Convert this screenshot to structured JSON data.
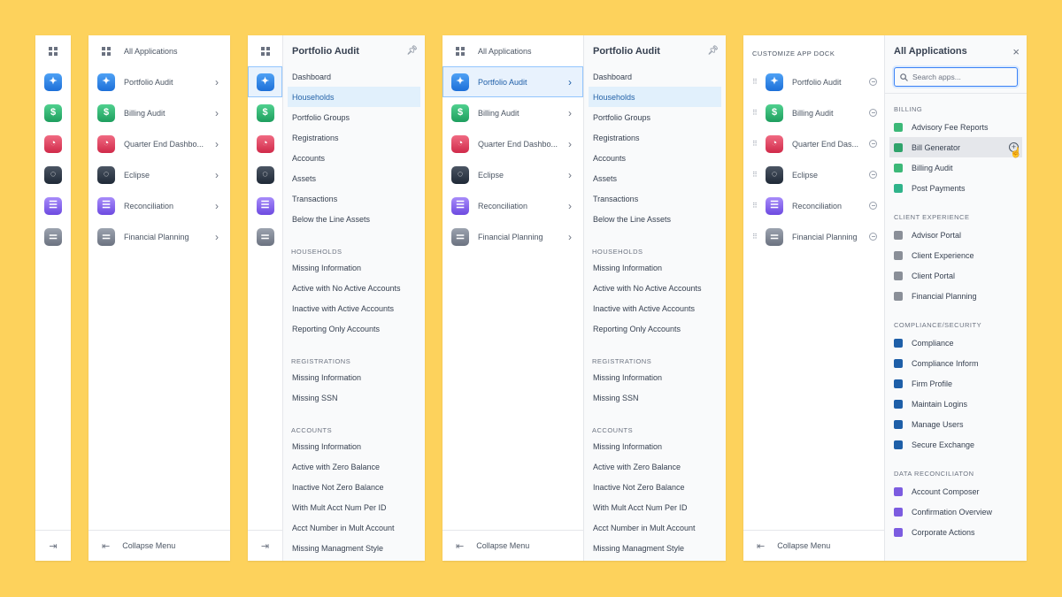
{
  "panel1": {
    "apps": [
      {
        "icon": "portfolio-audit-icon"
      },
      {
        "icon": "billing-audit-icon"
      },
      {
        "icon": "quarter-end-dashboard-icon"
      },
      {
        "icon": "eclipse-icon"
      },
      {
        "icon": "reconciliation-icon"
      },
      {
        "icon": "financial-planning-icon"
      }
    ]
  },
  "panel2": {
    "header": "All Applications",
    "apps": [
      {
        "label": "Portfolio Audit"
      },
      {
        "label": "Billing Audit"
      },
      {
        "label": "Quarter End Dashbo..."
      },
      {
        "label": "Eclipse"
      },
      {
        "label": "Reconciliation"
      },
      {
        "label": "Financial Planning"
      }
    ],
    "collapse": "Collapse Menu"
  },
  "submenu": {
    "title": "Portfolio Audit",
    "top": [
      "Dashboard",
      "Households",
      "Portfolio Groups",
      "Registrations",
      "Accounts",
      "Assets",
      "Transactions",
      "Below the Line Assets"
    ],
    "households_title": "HOUSEHOLDS",
    "households": [
      "Missing Information",
      "Active with No Active Accounts",
      "Inactive with Active Accounts",
      "Reporting Only Accounts"
    ],
    "registrations_title": "REGISTRATIONS",
    "registrations": [
      "Missing Information",
      "Missing SSN"
    ],
    "accounts_title": "ACCOUNTS",
    "accounts": [
      "Missing Information",
      "Active with Zero Balance",
      "Inactive Not Zero Balance",
      "With Mult Acct Num Per ID",
      "Acct Number in Mult Account",
      "Missing Managment Style"
    ]
  },
  "panel4": {
    "header": "All Applications",
    "apps": [
      {
        "label": "Portfolio Audit"
      },
      {
        "label": "Billing Audit"
      },
      {
        "label": "Quarter End Dashbo..."
      },
      {
        "label": "Eclipse"
      },
      {
        "label": "Reconciliation"
      },
      {
        "label": "Financial Planning"
      }
    ],
    "collapse": "Collapse Menu"
  },
  "dock": {
    "title": "CUSTOMIZE APP DOCK",
    "apps": [
      {
        "label": "Portfolio Audit"
      },
      {
        "label": "Billing Audit"
      },
      {
        "label": "Quarter End Das..."
      },
      {
        "label": "Eclipse"
      },
      {
        "label": "Reconciliation"
      },
      {
        "label": "Financial Planning"
      }
    ],
    "collapse": "Collapse Menu"
  },
  "catalog": {
    "title": "All Applications",
    "close": "×",
    "search_placeholder": "Search apps...",
    "sections": [
      {
        "title": "BILLING",
        "items": [
          {
            "label": "Advisory Fee Reports",
            "color": "#3CB878"
          },
          {
            "label": "Bill Generator",
            "color": "#2FA36B"
          },
          {
            "label": "Billing Audit",
            "color": "#3CB878"
          },
          {
            "label": "Post Payments",
            "color": "#2FB38A"
          }
        ]
      },
      {
        "title": "CLIENT EXPERIENCE",
        "items": [
          {
            "label": "Advisor Portal",
            "color": "#8A8F98"
          },
          {
            "label": "Client Experience",
            "color": "#8A8F98"
          },
          {
            "label": "Client Portal",
            "color": "#8A8F98"
          },
          {
            "label": "Financial Planning",
            "color": "#8A8F98"
          }
        ]
      },
      {
        "title": "COMPLIANCE/SECURITY",
        "items": [
          {
            "label": "Compliance",
            "color": "#1E5FA8"
          },
          {
            "label": "Compliance Inform",
            "color": "#1E5FA8"
          },
          {
            "label": "Firm Profile",
            "color": "#1E5FA8"
          },
          {
            "label": "Maintain Logins",
            "color": "#1E5FA8"
          },
          {
            "label": "Manage Users",
            "color": "#1E5FA8"
          },
          {
            "label": "Secure Exchange",
            "color": "#1E5FA8"
          }
        ]
      },
      {
        "title": "DATA RECONCILIATON",
        "items": [
          {
            "label": "Account Composer",
            "color": "#7C5CE0"
          },
          {
            "label": "Confirmation Overview",
            "color": "#7C5CE0"
          },
          {
            "label": "Corporate Actions",
            "color": "#7C5CE0"
          }
        ]
      }
    ]
  },
  "colors": {
    "background": "#FDD25C",
    "accent": "#3B82F6",
    "selected_bg": "#E1F0FC"
  }
}
